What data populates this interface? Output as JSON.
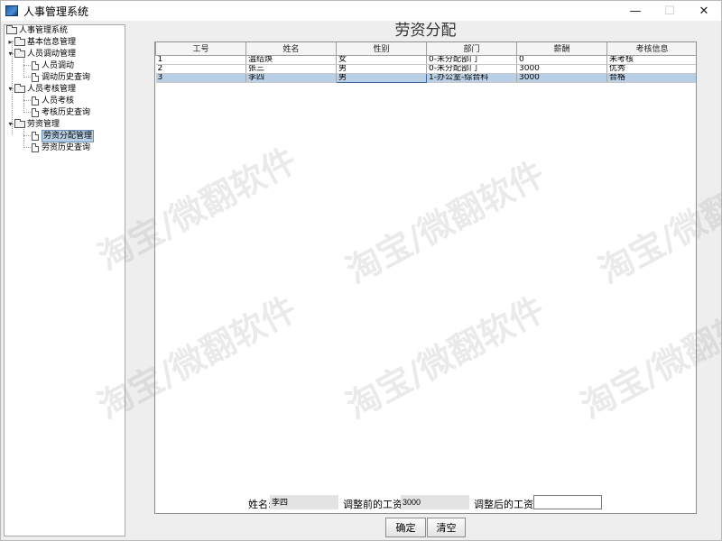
{
  "window": {
    "title": "人事管理系统"
  },
  "tree": {
    "root": "人事管理系统",
    "nodes": [
      {
        "label": "基本信息管理",
        "type": "folder",
        "expanded": false
      },
      {
        "label": "人员调动管理",
        "type": "folder",
        "expanded": true,
        "children": [
          {
            "label": "人员调动"
          },
          {
            "label": "调动历史查询"
          }
        ]
      },
      {
        "label": "人员考核管理",
        "type": "folder",
        "expanded": true,
        "children": [
          {
            "label": "人员考核"
          },
          {
            "label": "考核历史查询"
          }
        ]
      },
      {
        "label": "劳资管理",
        "type": "folder",
        "expanded": true,
        "children": [
          {
            "label": "劳资分配管理",
            "selected": true
          },
          {
            "label": "劳资历史查询"
          }
        ]
      }
    ]
  },
  "main": {
    "title": "劳资分配",
    "table": {
      "columns": [
        "工号",
        "姓名",
        "性别",
        "部门",
        "薪酬",
        "考核信息"
      ],
      "rows": [
        [
          "1",
          "温结焕",
          "女",
          "0-未分配部门",
          "0",
          "未考核"
        ],
        [
          "2",
          "张三",
          "男",
          "0-未分配部门",
          "3000",
          "优秀"
        ],
        [
          "3",
          "李四",
          "男",
          "1-办公室-综合科",
          "3000",
          "合格"
        ]
      ],
      "selected_row": 2
    },
    "form": {
      "name_label": "姓名:",
      "name_value": "李四",
      "before_label": "调整前的工资:",
      "before_value": "3000",
      "after_label": "调整后的工资:",
      "after_value": ""
    },
    "buttons": {
      "confirm": "确定",
      "clear": "清空"
    }
  },
  "watermark": "淘宝/微翻软件"
}
